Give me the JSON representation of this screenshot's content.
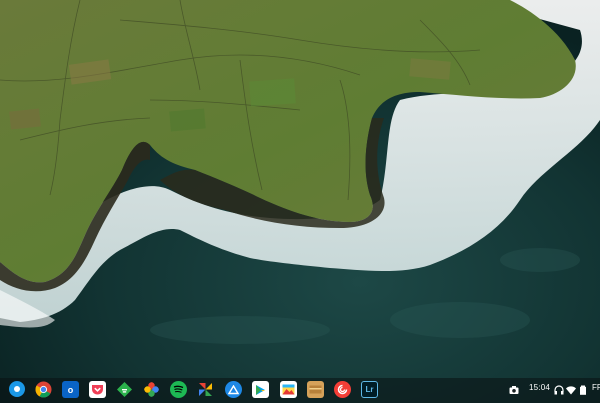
{
  "wallpaper": {
    "description_icon": "coastal-cliffs-wallpaper"
  },
  "shelf": {
    "launcher_icon": "launcher-icon",
    "apps": [
      {
        "name": "chrome-icon",
        "label": ""
      },
      {
        "name": "outlook-icon",
        "label": "o"
      },
      {
        "name": "pocket-icon",
        "label": ""
      },
      {
        "name": "feedly-icon",
        "label": ""
      },
      {
        "name": "photos-icon",
        "label": ""
      },
      {
        "name": "spotify-icon",
        "label": ""
      },
      {
        "name": "pinwheel-app-icon",
        "label": ""
      },
      {
        "name": "drive-style-app-icon",
        "label": ""
      },
      {
        "name": "play-store-icon",
        "label": ""
      },
      {
        "name": "gallery-icon",
        "label": ""
      },
      {
        "name": "wallet-icon",
        "label": ""
      },
      {
        "name": "pocket-casts-icon",
        "label": ""
      },
      {
        "name": "lightroom-icon",
        "label": "Lr"
      }
    ],
    "tray": {
      "time": "15:04",
      "ime": "FR",
      "icons": [
        "screenshot-icon",
        "headphones-icon",
        "wifi-icon",
        "battery-icon"
      ]
    }
  },
  "colors": {
    "shelf_bg": "#0a1012",
    "launcher_blue": "#1b98e6"
  }
}
